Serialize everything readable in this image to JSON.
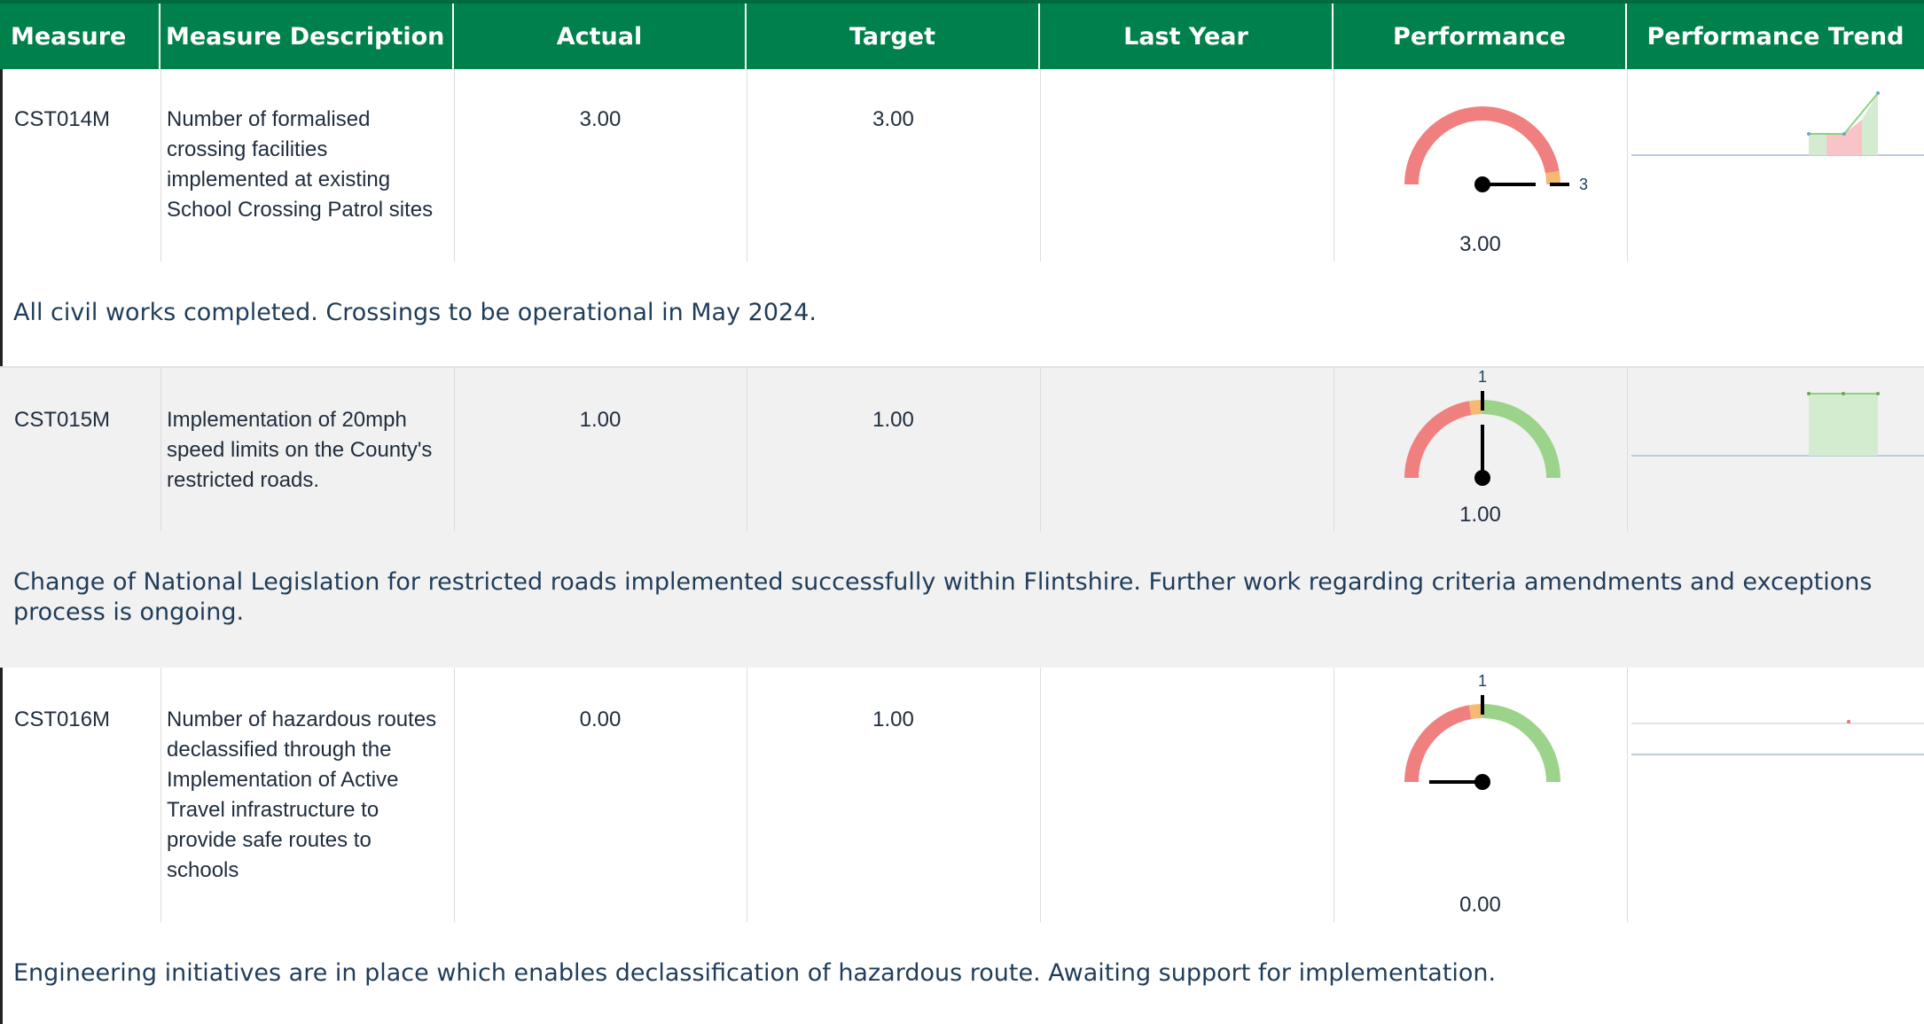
{
  "header": {
    "measure": "Measure",
    "description": "Measure Description",
    "actual": "Actual",
    "target": "Target",
    "last_year": "Last Year",
    "performance": "Performance",
    "trend": "Performance Trend"
  },
  "rows": [
    {
      "code": "CST014M",
      "description": "Number of formalised crossing facilities implemented at existing School Crossing Patrol sites",
      "actual": "3.00",
      "target": "3.00",
      "last_year": "",
      "gauge_value": 3,
      "gauge_target_label": "3",
      "gauge_value_label": "3.00",
      "note": "All civil works completed. Crossings to be operational in May 2024."
    },
    {
      "code": "CST015M",
      "description": "Implementation of 20mph speed limits on the County's restricted roads.",
      "actual": "1.00",
      "target": "1.00",
      "last_year": "",
      "gauge_value": 1,
      "gauge_target_label": "1",
      "gauge_value_label": "1.00",
      "note": "Change of National Legislation for restricted roads implemented successfully within Flintshire. Further work regarding criteria amendments and exceptions process is ongoing."
    },
    {
      "code": "CST016M",
      "description": "Number of hazardous routes declassified through the Implementation of Active Travel infrastructure to provide safe routes to schools",
      "actual": "0.00",
      "target": "1.00",
      "last_year": "",
      "gauge_value": 0,
      "gauge_target_label": "1",
      "gauge_value_label": "0.00",
      "note": "Engineering initiatives are in place which enables declassification of hazardous route. Awaiting support for implementation."
    }
  ],
  "colors": {
    "header_bg": "#00804a",
    "gauge_red": "#f08080",
    "gauge_amber": "#f5b971",
    "gauge_green": "#9cd38a",
    "trend_green_fill": "#d3ecd0",
    "trend_red_fill": "#f8c4c8",
    "baseline": "#b8cde0"
  }
}
